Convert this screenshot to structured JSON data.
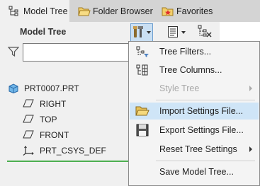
{
  "tabs": [
    {
      "label": "Model Tree",
      "icon": "model-tree-icon",
      "active": true
    },
    {
      "label": "Folder Browser",
      "icon": "folder-icon",
      "active": false
    },
    {
      "label": "Favorites",
      "icon": "favorites-star-icon",
      "active": false
    }
  ],
  "panel": {
    "title": "Model Tree",
    "search_placeholder": ""
  },
  "tree": {
    "root": "PRT0007.PRT",
    "items": [
      "RIGHT",
      "TOP",
      "FRONT",
      "PRT_CSYS_DEF"
    ]
  },
  "menu": {
    "items": [
      {
        "label": "Tree Filters...",
        "icon": "tree-filters-icon",
        "enabled": true
      },
      {
        "label": "Tree Columns...",
        "icon": "tree-columns-icon",
        "enabled": true
      },
      {
        "label": "Style Tree",
        "icon": "",
        "enabled": false,
        "submenu": true
      },
      {
        "label": "Import Settings File...",
        "icon": "open-folder-icon",
        "enabled": true,
        "highlighted": true
      },
      {
        "label": "Export Settings File...",
        "icon": "floppy-disk-icon",
        "enabled": true
      },
      {
        "label": "Reset Tree Settings",
        "icon": "",
        "enabled": true,
        "submenu": true
      },
      {
        "label": "Save Model Tree...",
        "icon": "",
        "enabled": true
      }
    ]
  },
  "colors": {
    "highlight": "#cfe5f7",
    "active_button": "#c9dff3",
    "accent_green": "#4caf50"
  }
}
